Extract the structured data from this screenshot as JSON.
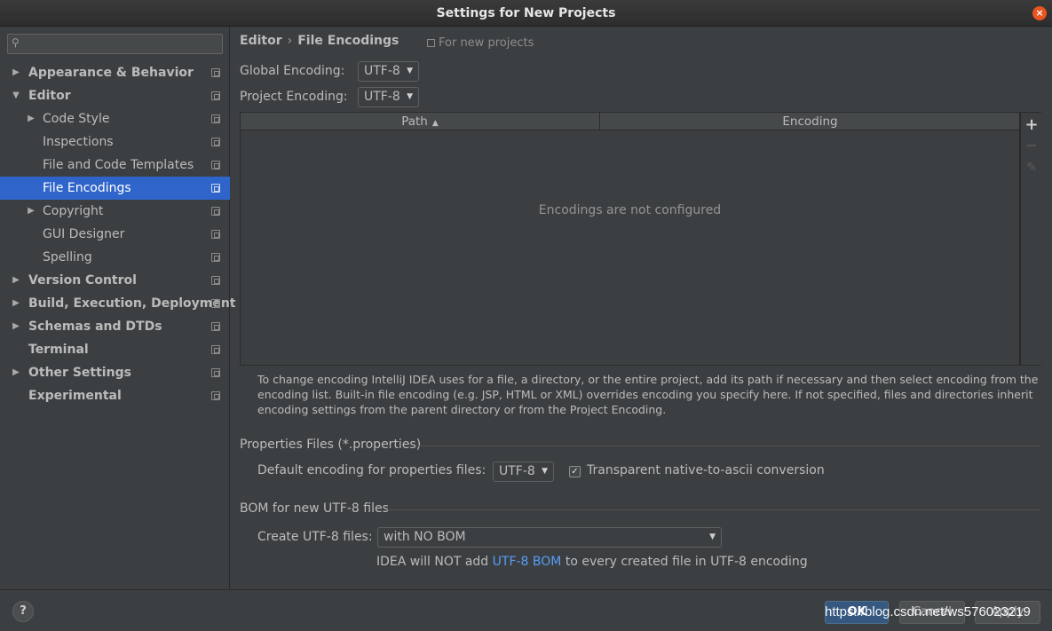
{
  "window": {
    "title": "Settings for New Projects"
  },
  "sidebar": {
    "search_placeholder": "",
    "items": [
      {
        "label": "Appearance & Behavior",
        "level": 0,
        "bold": true,
        "arrow": "▶"
      },
      {
        "label": "Editor",
        "level": 0,
        "bold": true,
        "arrow": "▼"
      },
      {
        "label": "Code Style",
        "level": 1,
        "bold": false,
        "arrow": "▶"
      },
      {
        "label": "Inspections",
        "level": 1,
        "bold": false,
        "arrow": ""
      },
      {
        "label": "File and Code Templates",
        "level": 1,
        "bold": false,
        "arrow": ""
      },
      {
        "label": "File Encodings",
        "level": 1,
        "bold": false,
        "arrow": "",
        "selected": true
      },
      {
        "label": "Copyright",
        "level": 1,
        "bold": false,
        "arrow": "▶"
      },
      {
        "label": "GUI Designer",
        "level": 1,
        "bold": false,
        "arrow": ""
      },
      {
        "label": "Spelling",
        "level": 1,
        "bold": false,
        "arrow": ""
      },
      {
        "label": "Version Control",
        "level": 0,
        "bold": true,
        "arrow": "▶"
      },
      {
        "label": "Build, Execution, Deployment",
        "level": 0,
        "bold": true,
        "arrow": "▶"
      },
      {
        "label": "Schemas and DTDs",
        "level": 0,
        "bold": true,
        "arrow": "▶"
      },
      {
        "label": "Terminal",
        "level": 0,
        "bold": true,
        "arrow": ""
      },
      {
        "label": "Other Settings",
        "level": 0,
        "bold": true,
        "arrow": "▶"
      },
      {
        "label": "Experimental",
        "level": 0,
        "bold": true,
        "arrow": ""
      }
    ]
  },
  "breadcrumb": {
    "parent": "Editor",
    "separator": "›",
    "current": "File Encodings",
    "scope": "For new projects"
  },
  "encodings": {
    "global_label": "Global Encoding:",
    "global_value": "UTF-8",
    "project_label": "Project Encoding:",
    "project_value": "UTF-8"
  },
  "table": {
    "columns": [
      "Path",
      "Encoding"
    ],
    "sort_indicator": "▲",
    "empty_text": "Encodings are not configured",
    "rows": []
  },
  "toolbar": {
    "add": "+",
    "remove": "−",
    "edit": "✎"
  },
  "help_text": "To change encoding IntelliJ IDEA uses for a file, a directory, or the entire project, add its path if necessary and then select encoding from the encoding list. Built-in file encoding (e.g. JSP, HTML or XML) overrides encoding you specify here. If not specified, files and directories inherit encoding settings from the parent directory or from the Project Encoding.",
  "properties": {
    "section_title": "Properties Files (*.properties)",
    "default_label": "Default encoding for properties files:",
    "default_value": "UTF-8",
    "native_to_ascii_label": "Transparent native-to-ascii conversion",
    "native_to_ascii_checked": true
  },
  "bom": {
    "section_title": "BOM for new UTF-8 files",
    "create_label": "Create UTF-8 files:",
    "create_value": "with NO BOM",
    "note_prefix": "IDEA will NOT add",
    "note_link": "UTF-8 BOM",
    "note_suffix": "to every created file in UTF-8 encoding"
  },
  "footer": {
    "help": "?",
    "ok": "OK",
    "cancel": "Cancel",
    "apply": "Apply"
  },
  "watermark": "https://blog.csdn.net/ws576023219",
  "colors": {
    "background": "#3c3f41",
    "selection": "#2f65ca",
    "link": "#589df6",
    "ok_button": "#365880",
    "close_button": "#e95420"
  }
}
